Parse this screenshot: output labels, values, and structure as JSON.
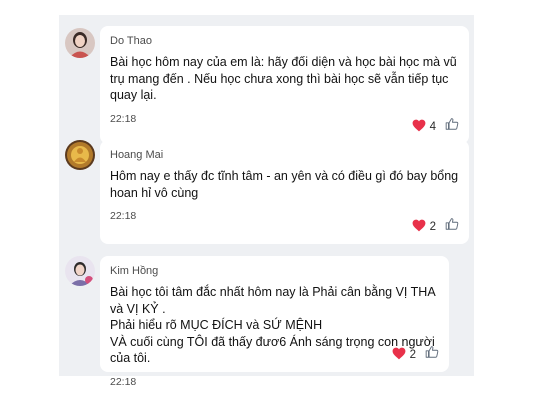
{
  "comments": [
    {
      "author": "Do Thao",
      "text": "Bài học hôm nay của em là: hãy đối diện và học bài học mà vũ trụ mang đến . Nếu học chưa xong thì bài học sẽ vẫn tiếp tục quay lại.",
      "time": "22:18",
      "heart_count": "4",
      "avatar_icon": "avatar-photo-woman"
    },
    {
      "author": "Hoang Mai",
      "text": "Hôm nay e thấy đc tĩnh tâm - an yên và có điều gì đó bay bổng hoan hỉ vô cùng",
      "time": "22:18",
      "heart_count": "2",
      "avatar_icon": "avatar-photo-buddha"
    },
    {
      "author": "Kim Hồng",
      "text": "Bài học tôi tâm đắc nhất hôm nay là Phải cân bằng VỊ THA và VỊ KỶ .\nPhải hiểu rõ MỤC ĐÍCH và SỨ MỆNH\nVÀ cuối cùng TÔI đã thấy đươ6 Ánh sáng trọng con người của tôi.",
      "time": "22:18",
      "heart_count": "2",
      "avatar_icon": "avatar-photo-person"
    }
  ],
  "colors": {
    "panel_bg": "#eef0f3",
    "bubble_bg": "#ffffff",
    "heart": "#e8314a",
    "like_outline": "#5f6b7a"
  }
}
